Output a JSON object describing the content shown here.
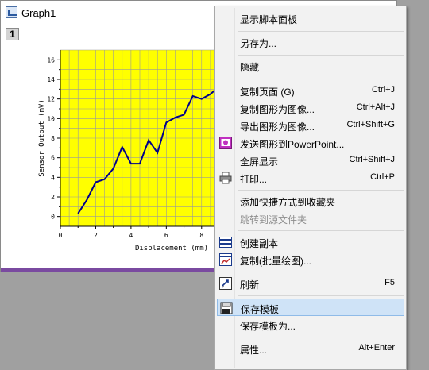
{
  "window": {
    "title": "Graph1",
    "layer_tab": "1"
  },
  "chart_data": {
    "type": "line",
    "title": "",
    "xlabel": "Displacement (mm)",
    "ylabel": "Sensor Output (mV)",
    "xlim": [
      0,
      9
    ],
    "ylim": [
      -1,
      17
    ],
    "x_ticks": [
      0,
      2,
      4,
      6,
      8
    ],
    "y_ticks": [
      0,
      2,
      4,
      6,
      8,
      10,
      12,
      14,
      16
    ],
    "grid": true,
    "background": "#ffff00",
    "line_color": "#00008b",
    "series": [
      {
        "x": [
          1.0,
          1.5,
          2.0,
          2.5,
          3.0,
          3.5,
          4.0,
          4.5,
          5.0,
          5.5,
          6.0,
          6.5,
          7.0,
          7.5,
          8.0,
          8.5,
          9.0
        ],
        "values": [
          0.3,
          1.7,
          3.5,
          3.8,
          4.9,
          7.1,
          5.4,
          5.4,
          7.8,
          6.5,
          9.6,
          10.1,
          10.4,
          12.3,
          12.0,
          12.5,
          13.3
        ]
      }
    ]
  },
  "menu": {
    "items": [
      {
        "label": "显示脚本面板",
        "shortcut": ""
      },
      {
        "label": "另存为...",
        "shortcut": ""
      },
      {
        "label": "隐藏",
        "shortcut": ""
      },
      {
        "label": "复制页面 (G)",
        "shortcut": "Ctrl+J"
      },
      {
        "label": "复制图形为图像...",
        "shortcut": "Ctrl+Alt+J"
      },
      {
        "label": "导出图形为图像...",
        "shortcut": "Ctrl+Shift+G"
      },
      {
        "label": "发送图形到PowerPoint...",
        "shortcut": "",
        "icon": "powerpoint-icon"
      },
      {
        "label": "全屏显示",
        "shortcut": "Ctrl+Shift+J"
      },
      {
        "label": "打印...",
        "shortcut": "Ctrl+P",
        "icon": "printer-icon"
      },
      {
        "label": "添加快捷方式到收藏夹",
        "shortcut": ""
      },
      {
        "label": "跳转到源文件夹",
        "shortcut": "",
        "disabled": true
      },
      {
        "label": "创建副本",
        "shortcut": "",
        "icon": "duplicate-icon"
      },
      {
        "label": "复制(批量绘图)...",
        "shortcut": "",
        "icon": "batch-plot-icon"
      },
      {
        "label": "刷新",
        "shortcut": "F5",
        "icon": "refresh-icon"
      },
      {
        "label": "保存模板",
        "shortcut": "",
        "icon": "save-template-icon",
        "highlighted": true
      },
      {
        "label": "保存模板为...",
        "shortcut": ""
      },
      {
        "label": "属性...",
        "shortcut": "Alt+Enter"
      }
    ]
  }
}
